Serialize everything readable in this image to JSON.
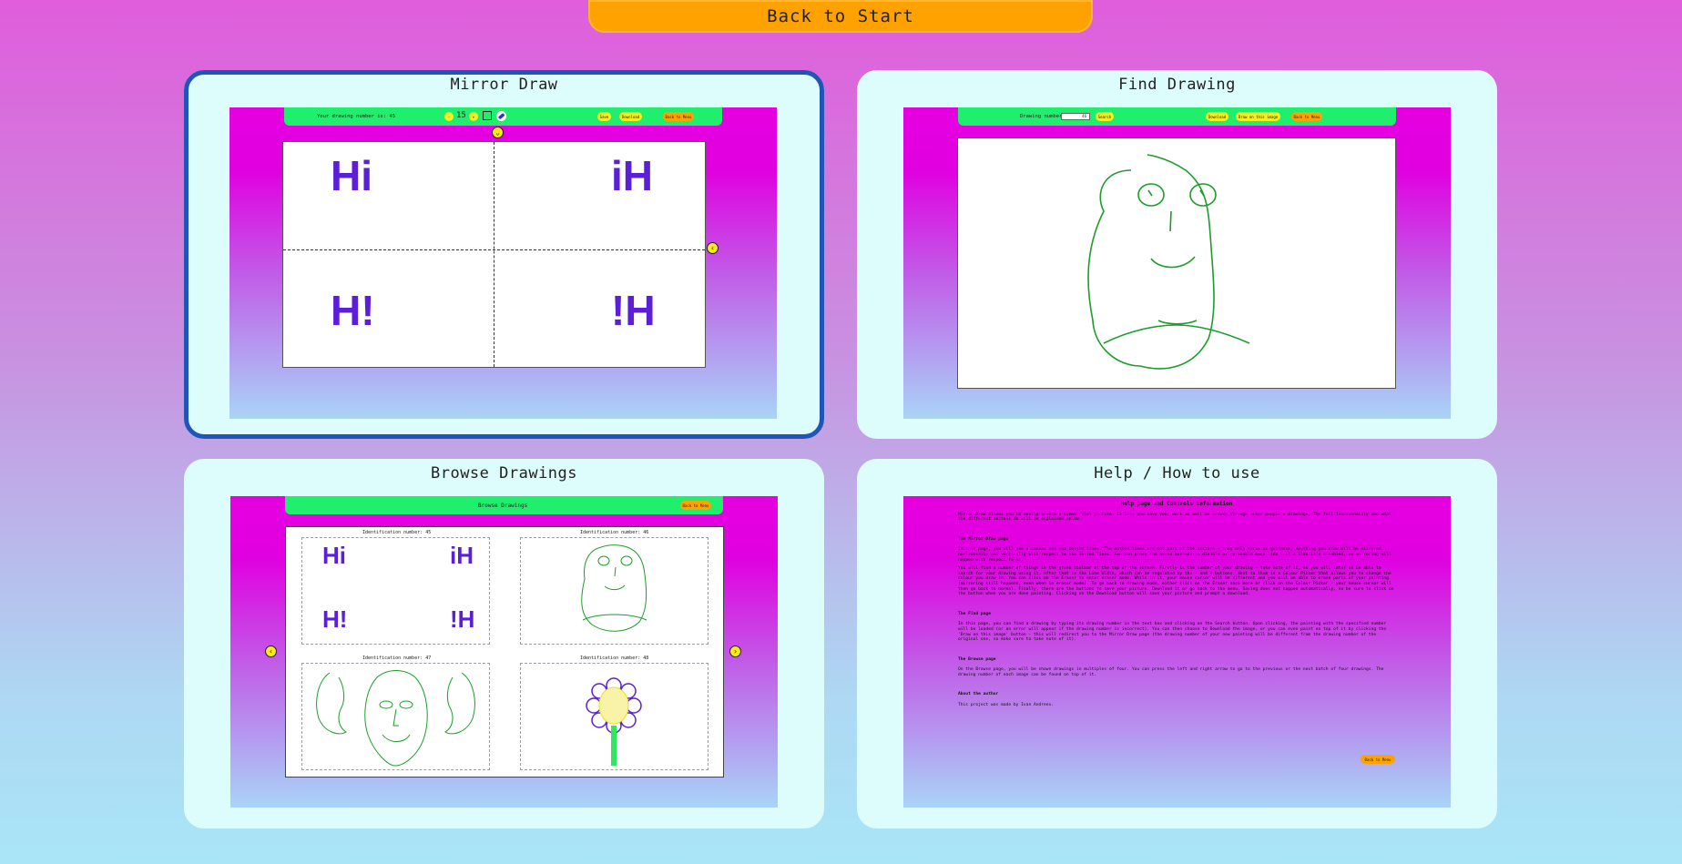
{
  "top": {
    "back_label": "Back to Start"
  },
  "cards": {
    "mirror": {
      "title": "Mirror Draw"
    },
    "find": {
      "title": "Find Drawing"
    },
    "browse": {
      "title": "Browse Drawings"
    },
    "help": {
      "title": "Help / How to use"
    }
  },
  "mirror_preview": {
    "drawing_number_text": "Your drawing number is: 45",
    "minus": "-",
    "plus": "+",
    "line_width": "15",
    "save": "Save",
    "download": "Download",
    "back_to_menu": "Back to Menu",
    "quadrant_text": {
      "tl": "Hi",
      "tr": "iH",
      "bl": "H!",
      "br": "!H"
    },
    "colors": {
      "letters": "#5a1fd6",
      "marks": "#2ee85e"
    }
  },
  "find_preview": {
    "drawing_number_label": "Drawing number:",
    "input_value": "46",
    "search": "Search",
    "download": "Download",
    "draw_on_image": "Draw on this image",
    "back_to_menu": "Back to Menu"
  },
  "browse_preview": {
    "title": "Browse Drawings",
    "back_to_menu": "Back to Menu",
    "items": [
      {
        "label": "Identification number: 45"
      },
      {
        "label": "Identification number: 46"
      },
      {
        "label": "Identification number: 47"
      },
      {
        "label": "Identification number: 48"
      }
    ]
  },
  "help_preview": {
    "heading": "Help page and Controls information",
    "intro": "Mirror Draw allows you to easily create a symmetrical picture. It lets you save your work as well as browse through other people's drawings. The full functionality and what the different buttons do will be explained below.",
    "mirror_heading": "The Mirror Draw page",
    "mirror_p1": "In this page, you will see a canvas and two dotted lines. The dotted lines are not part of the picture - they only serve as guidance. Anything you draw will be mirrored horizontally and vertically with respect to the dotted lines. You can press the arrow buttons to disable or re-enable each line - it's like it's disabled, no mirroring will happen with respect to it.",
    "mirror_p2": "You will find a number of things in the green toolbar at the top of the screen. Firstly is the number of your drawing - take note of it, as you will later on be able to search for your drawing using it. After that is the Line Width, which can be regulated by the - and + buttons. Next to them is a Colour Picker that allows you to change the colour you draw in. You can click on the Eraser to enter eraser mode. While in it, your mouse cursor will be different and you will be able to erase parts of your painting (mirroring still happens, even when in eraser mode). To go back to drawing mode, either click on the Eraser once more or click on the Colour Picker - your mouse cursor will then go back to normal. Finally, there are the buttons to save your picture. Download it or go back to the menu. Saving does not happen automatically, so be sure to click on the button when you are done painting. Clicking on the Download button will save your picture and prompt a download.",
    "find_heading": "The Find page",
    "find_p": "In this page, you can find a drawing by typing its drawing number in the text box and clicking on the Search button. Upon clicking, the painting with the specified number will be loaded (or an error will appear if the drawing number is incorrect). You can then choose to Download the image, or you can even paint on top of it by clicking the 'Draw on this image' button - this will redirect you to the Mirror Draw page (the drawing number of your new painting will be different from the drawing number of the original one, so make sure to take note of it).",
    "browse_heading": "The Browse page",
    "browse_p": "On the Browse page, you will be shown drawings in multiples of four. You can press the left and right arrow to go to the previous or the next batch of four drawings. The drawing number of each image can be found on top of it.",
    "author_heading": "About the author",
    "author_p": "This project was made by Ivan Andreev.",
    "back_to_menu": "Back to Menu"
  }
}
